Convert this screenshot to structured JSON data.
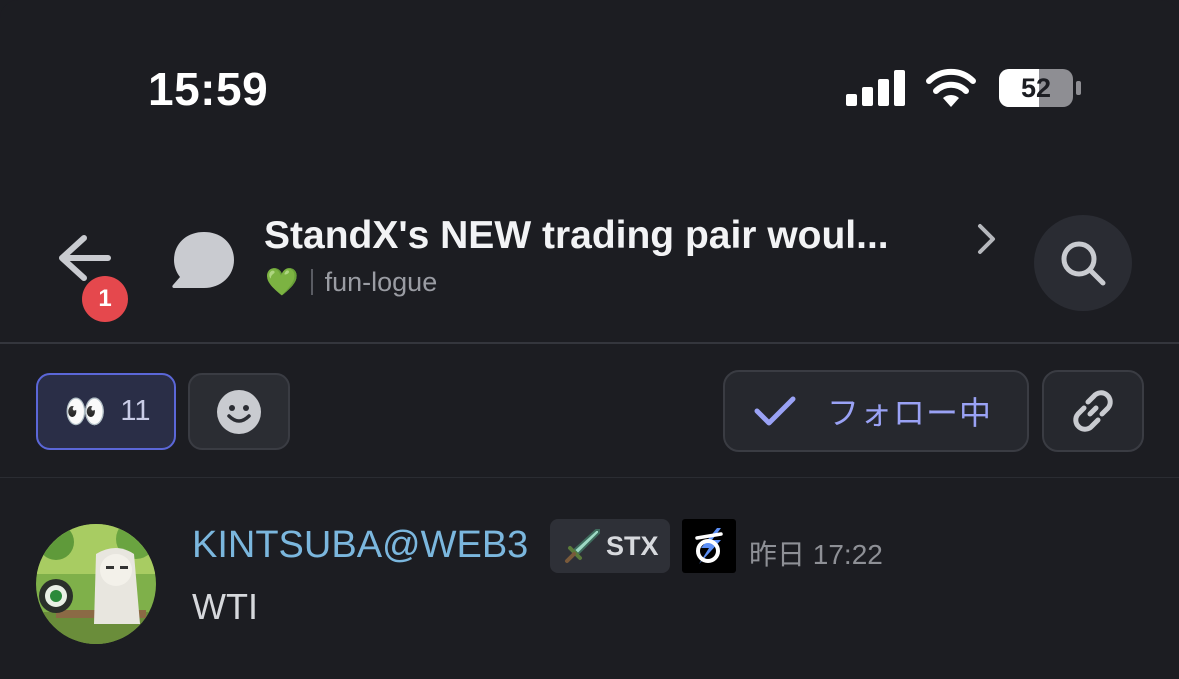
{
  "status_bar": {
    "time": "15:59",
    "battery": "52",
    "signal_icon": "cellular-signal-icon",
    "wifi_icon": "wifi-icon",
    "battery_icon": "battery-icon"
  },
  "header": {
    "back_icon": "arrow-left-icon",
    "back_badge": "1",
    "thread_icon": "speech-bubble-icon",
    "title": "StandX's NEW trading pair woul...",
    "emoji": "💚",
    "channel": "fun-logue",
    "chevron_icon": "chevron-right-icon",
    "search_icon": "search-icon"
  },
  "actions": {
    "reaction_emoji": "👀",
    "reaction_count": "11",
    "add_reaction_icon": "smiley-icon",
    "follow_label": "フォロー中",
    "follow_icon": "check-icon",
    "link_icon": "link-icon"
  },
  "message": {
    "username": "KINTSUBA@WEB3",
    "badge_text": "STX",
    "badge_icon": "sword-icon",
    "server_badge_icon": "server-logo-icon",
    "timestamp": "昨日 17:22",
    "text": "WTI"
  },
  "colors": {
    "background": "#1c1d22",
    "accent": "#5b67d8",
    "username": "#7bb7de",
    "badge_red": "#e5484d"
  }
}
